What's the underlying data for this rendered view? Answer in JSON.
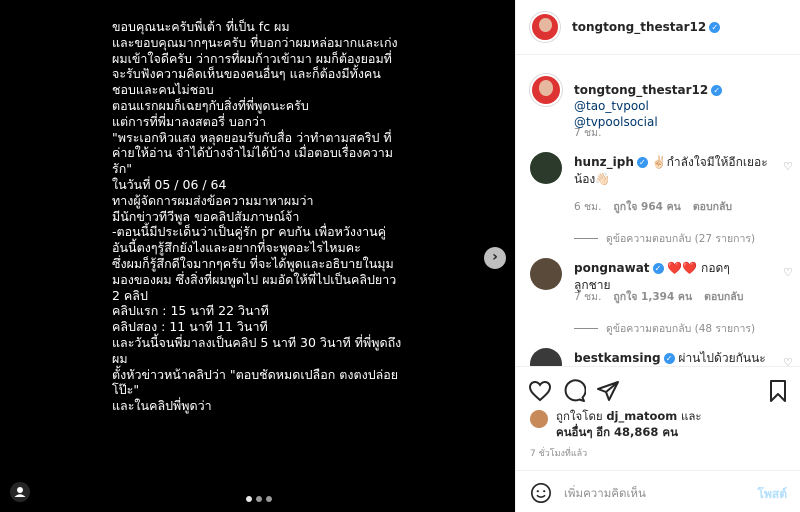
{
  "post": {
    "text": "ขอบคุณนะครับพี่เต้า ที่เป็น fc ผม\nและขอบคุณมากๆนะครับ ที่บอกว่าผมหล่อมากและเก่ง\nผมเข้าใจดีครับ ว่าการที่ผมก้าวเข้ามา ผมก็ต้องยอมที่\nจะรับฟังความคิดเห็นของคนอื่นๆ และก็ต้องมีทั้งคน\nชอบและคนไม่ชอบ\nตอนแรกผมก็เฉยๆกับสิ่งที่พี่พูดนะครับ\nแต่การที่พี่มาลงสตอรี่ บอกว่า\n\"พระเอกหิวแสง หลุดยอมรับกับสื่อ ว่าทำตามสคริป ที่\nค่ายให้อ่าน จำได้บ้างจำไม่ได้บ้าง เมื่อตอบเรื่องความ\nรัก\"\nในวันที่ 05 / 06 / 64\nทางผู้จัดการผมส่งข้อความมาหาผมว่า\nมีนักข่าวทีวีพูล ขอคลิปสัมภาษณ์จ้า\n-ตอนนี้มีประเด็นว่าเป็นคู่รัก pr คบกัน เพื่อหวังงานคู่\nอันนี้ตงๆรู้สึกยังไงและอยากที่จะพูดอะไรไหมคะ\nซึ่งผมก็รู้สึกดีใจมากๆครับ ที่จะได้พูดและอธิบายในมุม\nมองของผม ซึ่งสิ่งที่ผมพูดไป ผมอัดให้พี่ไปเป็นคลิปยาว\n2 คลิป\nคลิปแรก : 15 นาที 22 วินาที\nคลิปสอง : 11 นาที 11 วินาที\nและวันนี้จนพี่มาลงเป็นคลิป 5 นาที 30 วินาที ที่พี่พูดถึง\nผม\nตั้งหัวข่าวหน้าคลิปว่า \"ตอบชัดหมดเปลือก ตงตงปล่อย\nโป๊ะ\"\nและในคลิปพี่พูดว่า",
    "next_icon": "chevron-right-icon",
    "tag_icon": "user-icon",
    "carousel_count": 3,
    "carousel_active": 1
  },
  "header": {
    "username": "tongtong_thestar12",
    "verified": "✓"
  },
  "caption": {
    "username": "tongtong_thestar12",
    "mention1": "@tao_tvpool",
    "mention2": "@tvpoolsocial",
    "time": "7 ชม."
  },
  "comments": [
    {
      "username": "hunz_iph",
      "text": "✌🏻กำลังใจมีให้อีกเยอะน้อง👋🏻",
      "time": "6 ชม.",
      "likes": "ถูกใจ 964 คน",
      "reply": "ตอบกลับ",
      "view_replies": "ดูข้อความตอบกลับ (27 รายการ)"
    },
    {
      "username": "pongnawat",
      "text": "❤️❤️ กอดๆ ลูกชาย",
      "time": "7 ชม.",
      "likes": "ถูกใจ 1,394 คน",
      "reply": "ตอบกลับ",
      "view_replies": "ดูข้อความตอบกลับ (48 รายการ)"
    },
    {
      "username": "bestkamsing",
      "text": "ผ่านไปด้วยกันนะ"
    }
  ],
  "likes": {
    "line1_prefix": "ถูกใจโดย",
    "line1_user": "dj_matoom",
    "line1_suffix": "และ",
    "line2_prefix": "คนอื่นๆ",
    "line2_count": "อีก 48,868 คน"
  },
  "posted_ago": "7 ชั่วโมงที่แล้ว",
  "comment_box": {
    "placeholder": "เพิ่มความคิดเห็น",
    "post_label": "โพสต์"
  },
  "colors": {
    "accent": "#3897f0",
    "like_red": "#ed4956",
    "text": "#262626",
    "muted": "#8e8e8e"
  }
}
